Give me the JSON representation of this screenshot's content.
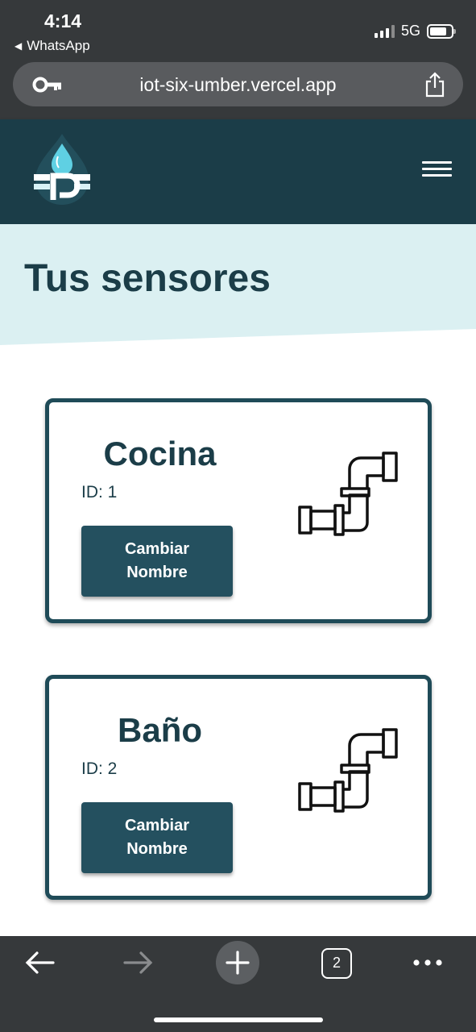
{
  "status_bar": {
    "time": "4:14",
    "back_app": "WhatsApp",
    "network": "5G"
  },
  "browser": {
    "url": "iot-six-umber.vercel.app",
    "tab_count": "2",
    "lock_icon": "key-icon",
    "share_icon": "share-icon"
  },
  "header": {
    "logo_icon": "water-drop-logo",
    "menu_icon": "hamburger-icon"
  },
  "hero": {
    "title": "Tus sensores"
  },
  "sensors": [
    {
      "name": "Cocina",
      "id_label": "ID: 1",
      "button_label": "Cambiar Nombre",
      "icon": "pipe-icon"
    },
    {
      "name": "Baño",
      "id_label": "ID: 2",
      "button_label": "Cambiar Nombre",
      "icon": "pipe-icon"
    }
  ],
  "colors": {
    "header_bg": "#1b3d48",
    "hero_bg": "#dbf0f2",
    "accent": "#24505f",
    "browser_chrome": "#36393b"
  }
}
